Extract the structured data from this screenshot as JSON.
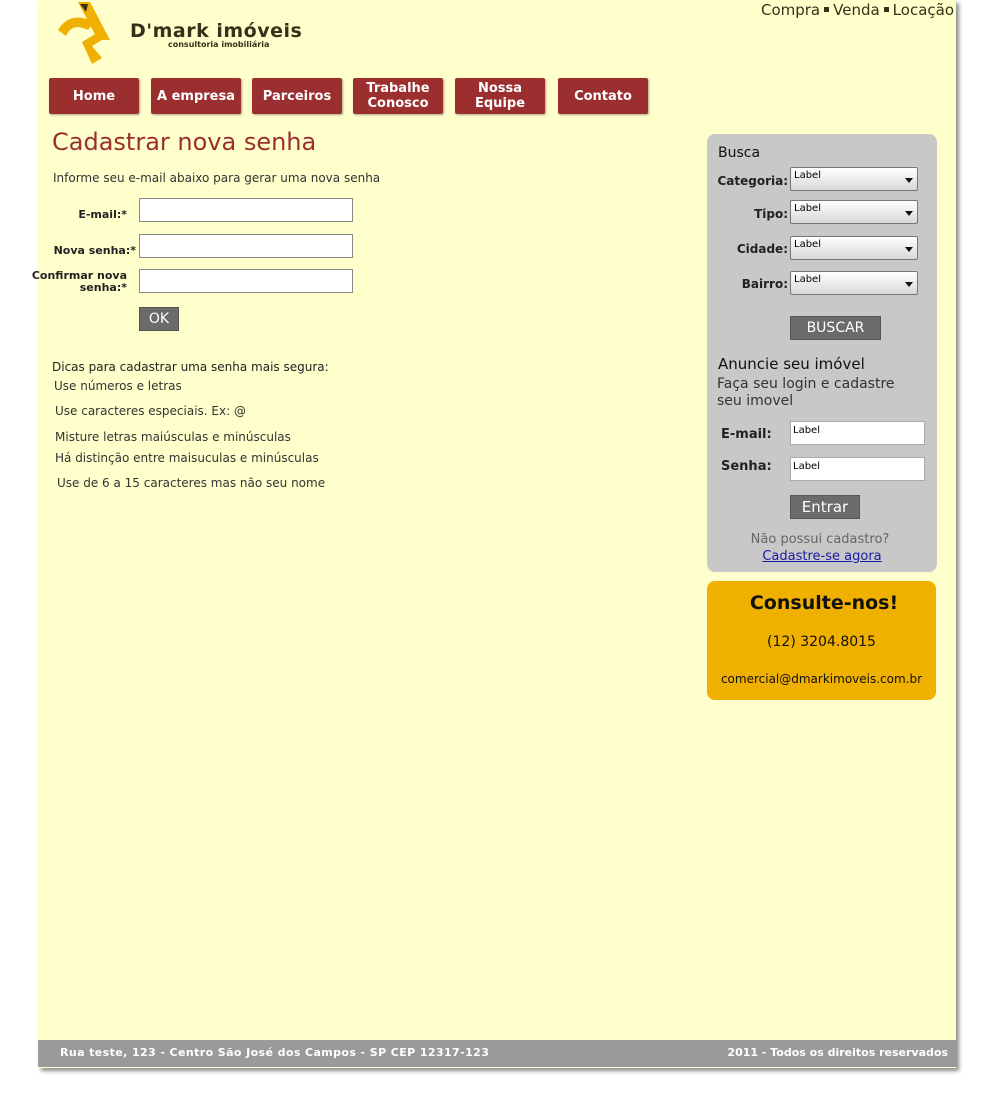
{
  "brand": {
    "name": "D'mark imóveis",
    "tagline": "consultoria imobiliária",
    "colors": {
      "background": "#ffffcc",
      "accent": "#9b2f30",
      "logo": "#f0b000"
    }
  },
  "top_links": [
    "Compra",
    "Venda",
    "Locação"
  ],
  "nav": {
    "items": [
      {
        "label": "Home"
      },
      {
        "label": "A empresa"
      },
      {
        "label": "Parceiros"
      },
      {
        "label": "Trabalhe Conosco"
      },
      {
        "label": "Nossa Equipe"
      },
      {
        "label": "Contato"
      }
    ]
  },
  "main": {
    "title": "Cadastrar nova senha",
    "intro": "Informe seu e-mail abaixo para gerar uma nova senha",
    "fields": {
      "email_label": "E-mail:*",
      "new_password_label": "Nova senha:*",
      "confirm_password_label_1": "Confirmar nova",
      "confirm_password_label_2": "senha:*"
    },
    "ok_label": "OK",
    "tips_title": "Dicas para cadastrar uma senha mais segura:",
    "tips": [
      "Use números e letras",
      "Use caracteres especiais. Ex: @",
      "Misture letras maiúsculas e minúsculas",
      "Há distinção entre maisuculas e minúsculas",
      "Use de 6 a 15 caracteres mas não seu nome"
    ]
  },
  "search": {
    "title": "Busca",
    "filters": [
      {
        "label": "Categoria:",
        "value": "Label"
      },
      {
        "label": "Tipo:",
        "value": "Label"
      },
      {
        "label": "Cidade:",
        "value": "Label"
      },
      {
        "label": "Bairro:",
        "value": "Label"
      }
    ],
    "button": "BUSCAR"
  },
  "announce": {
    "title": "Anuncie seu imóvel",
    "text": "Faça seu login e cadastre seu imovel",
    "email_label": "E-mail:",
    "email_value": "Label",
    "password_label": "Senha:",
    "password_value": "Label",
    "button": "Entrar",
    "no_account": "Não possui cadastro?",
    "signup_link": "Cadastre-se agora"
  },
  "contact": {
    "title": "Consulte-nos!",
    "phone": "(12) 3204.8015",
    "email": "comercial@dmarkimoveis.com.br"
  },
  "footer": {
    "address": "Rua teste, 123 - Centro São José dos Campos - SP CEP 12317-123",
    "copyright": "2011 - Todos os direitos reservados"
  }
}
